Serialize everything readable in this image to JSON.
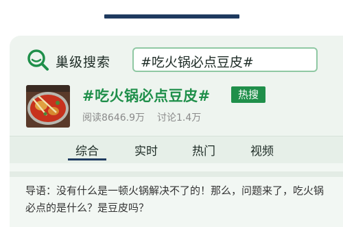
{
  "search": {
    "brand": "巢级搜索",
    "query": "#吃火锅必点豆皮#"
  },
  "topic": {
    "title": "#吃火锅必点豆皮#",
    "badge": "热搜",
    "reads": "阅读8646.9万",
    "discussions": "讨论1.4万"
  },
  "tabs": [
    {
      "label": "综合",
      "active": true
    },
    {
      "label": "实时",
      "active": false
    },
    {
      "label": "热门",
      "active": false
    },
    {
      "label": "视频",
      "active": false
    }
  ],
  "article": {
    "lead": "导语：没有什么是一顿火锅解决不了的！那么，问题来了，吃火锅必点的是什么？是豆皮吗？"
  },
  "colors": {
    "accent_green": "#1f8f4a",
    "nav_blue": "#1e3a5f",
    "panel_bg": "#eef4ef"
  },
  "icons": {
    "search": "search-icon",
    "thumbnail": "hotpot-image"
  }
}
